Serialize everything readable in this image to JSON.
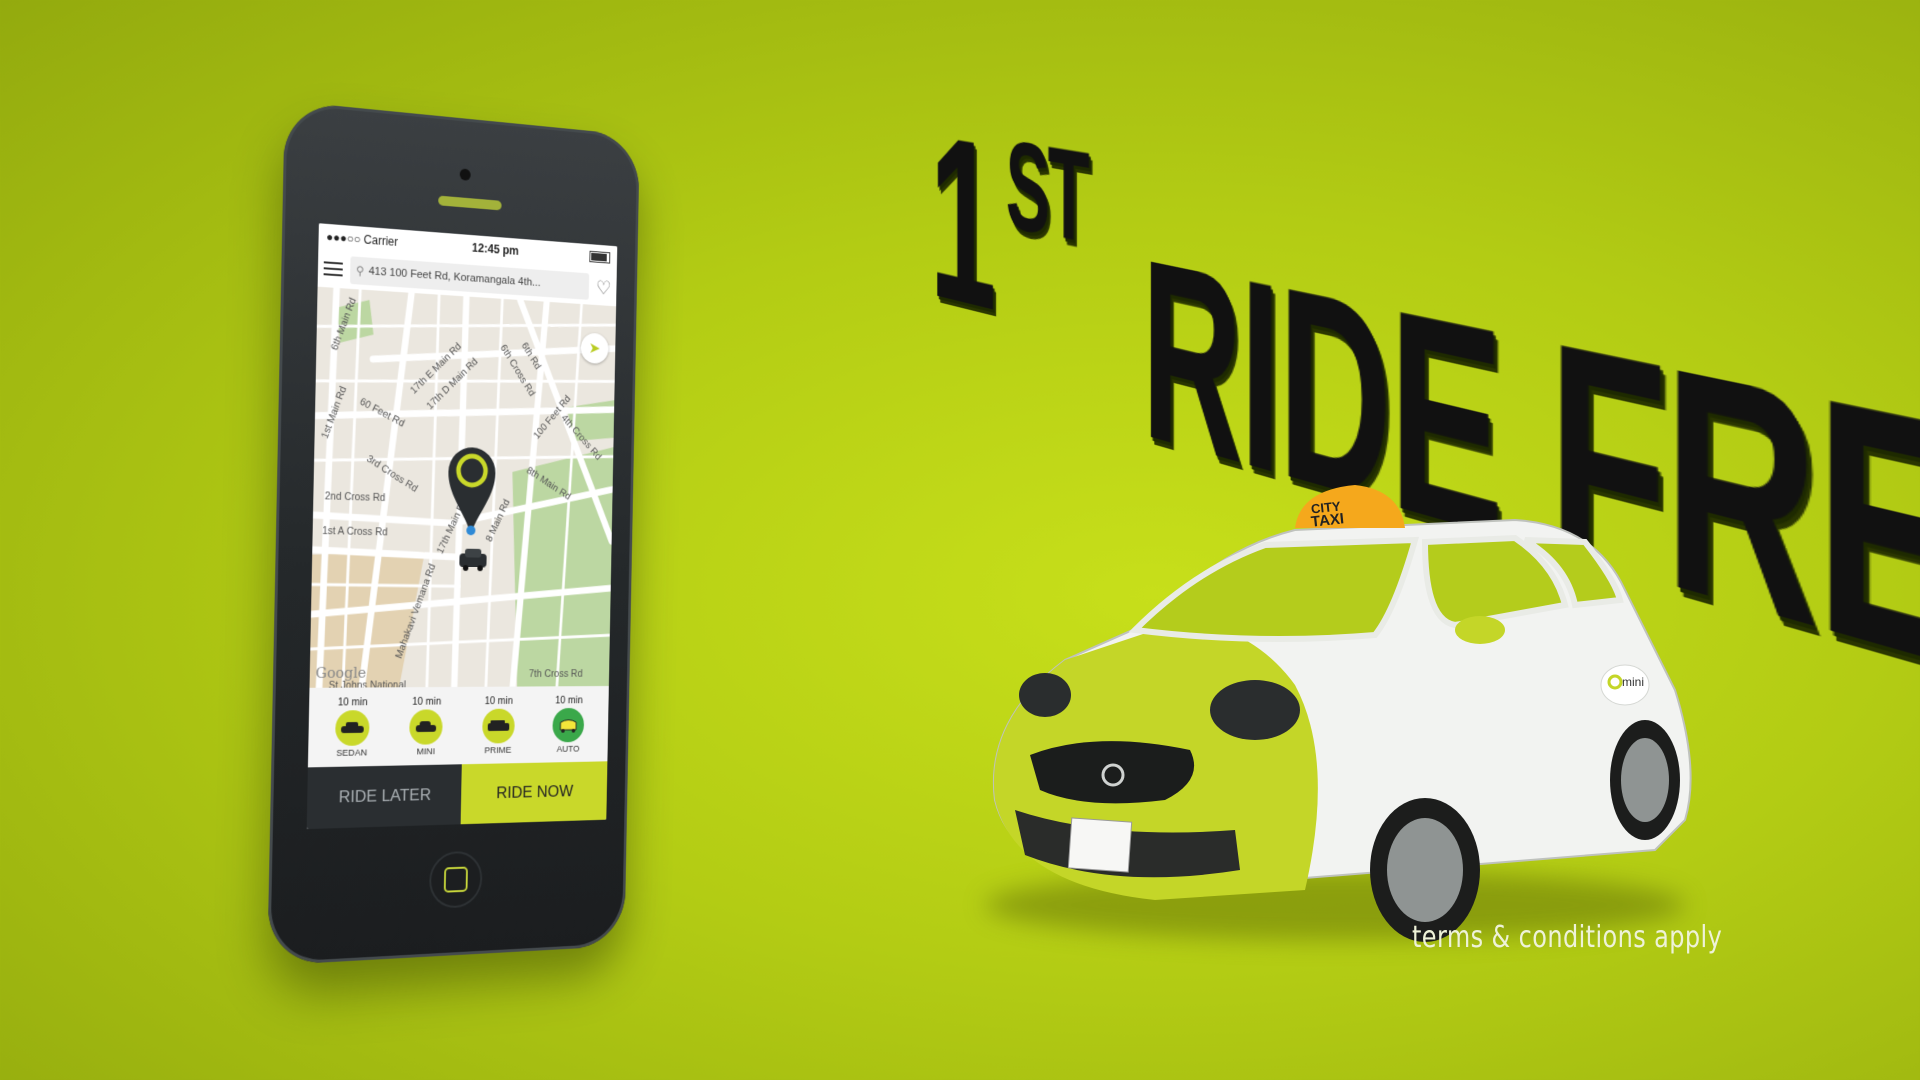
{
  "status_bar": {
    "carrier": "●●●○○ Carrier",
    "time": "12:45 pm"
  },
  "search": {
    "address": "413 100 Feet Rd, Koramangala 4th..."
  },
  "map": {
    "labels": [
      "6th Main Rd",
      "17th E Main Rd",
      "17th D Main Rd",
      "6th Cross Rd",
      "6th Rd",
      "1st Main Rd",
      "60 Feet Rd",
      "100 Feet Rd",
      "4th Cross Rd",
      "3rd Cross Rd",
      "2nd Cross Rd",
      "8th Main Rd",
      "1st A Cross Rd",
      "17th Main Rd",
      "8 Main Rd",
      "Mahakavi Vemana Rd",
      "7th Cross Rd",
      "St Johns National"
    ],
    "provider": "Google"
  },
  "vehicles": [
    {
      "eta": "10 min",
      "name": "SEDAN",
      "icon": "sedan-icon"
    },
    {
      "eta": "10 min",
      "name": "MINI",
      "icon": "mini-car-icon"
    },
    {
      "eta": "10 min",
      "name": "PRIME",
      "icon": "suv-icon"
    },
    {
      "eta": "10 min",
      "name": "AUTO",
      "icon": "auto-rickshaw-icon"
    }
  ],
  "buttons": {
    "ride_later": "RIDE LATER",
    "ride_now": "RIDE NOW"
  },
  "headline": {
    "number": "1",
    "suffix": "ST",
    "text": "RIDE FREE!"
  },
  "taxi": {
    "roof_sign_line1": "CITY",
    "roof_sign_line2": "TAXI",
    "door_brand": "mini"
  },
  "terms": "terms & conditions apply",
  "colors": {
    "accent": "#c9d82a",
    "background": "#b8d016",
    "dark": "#2a2e31"
  }
}
